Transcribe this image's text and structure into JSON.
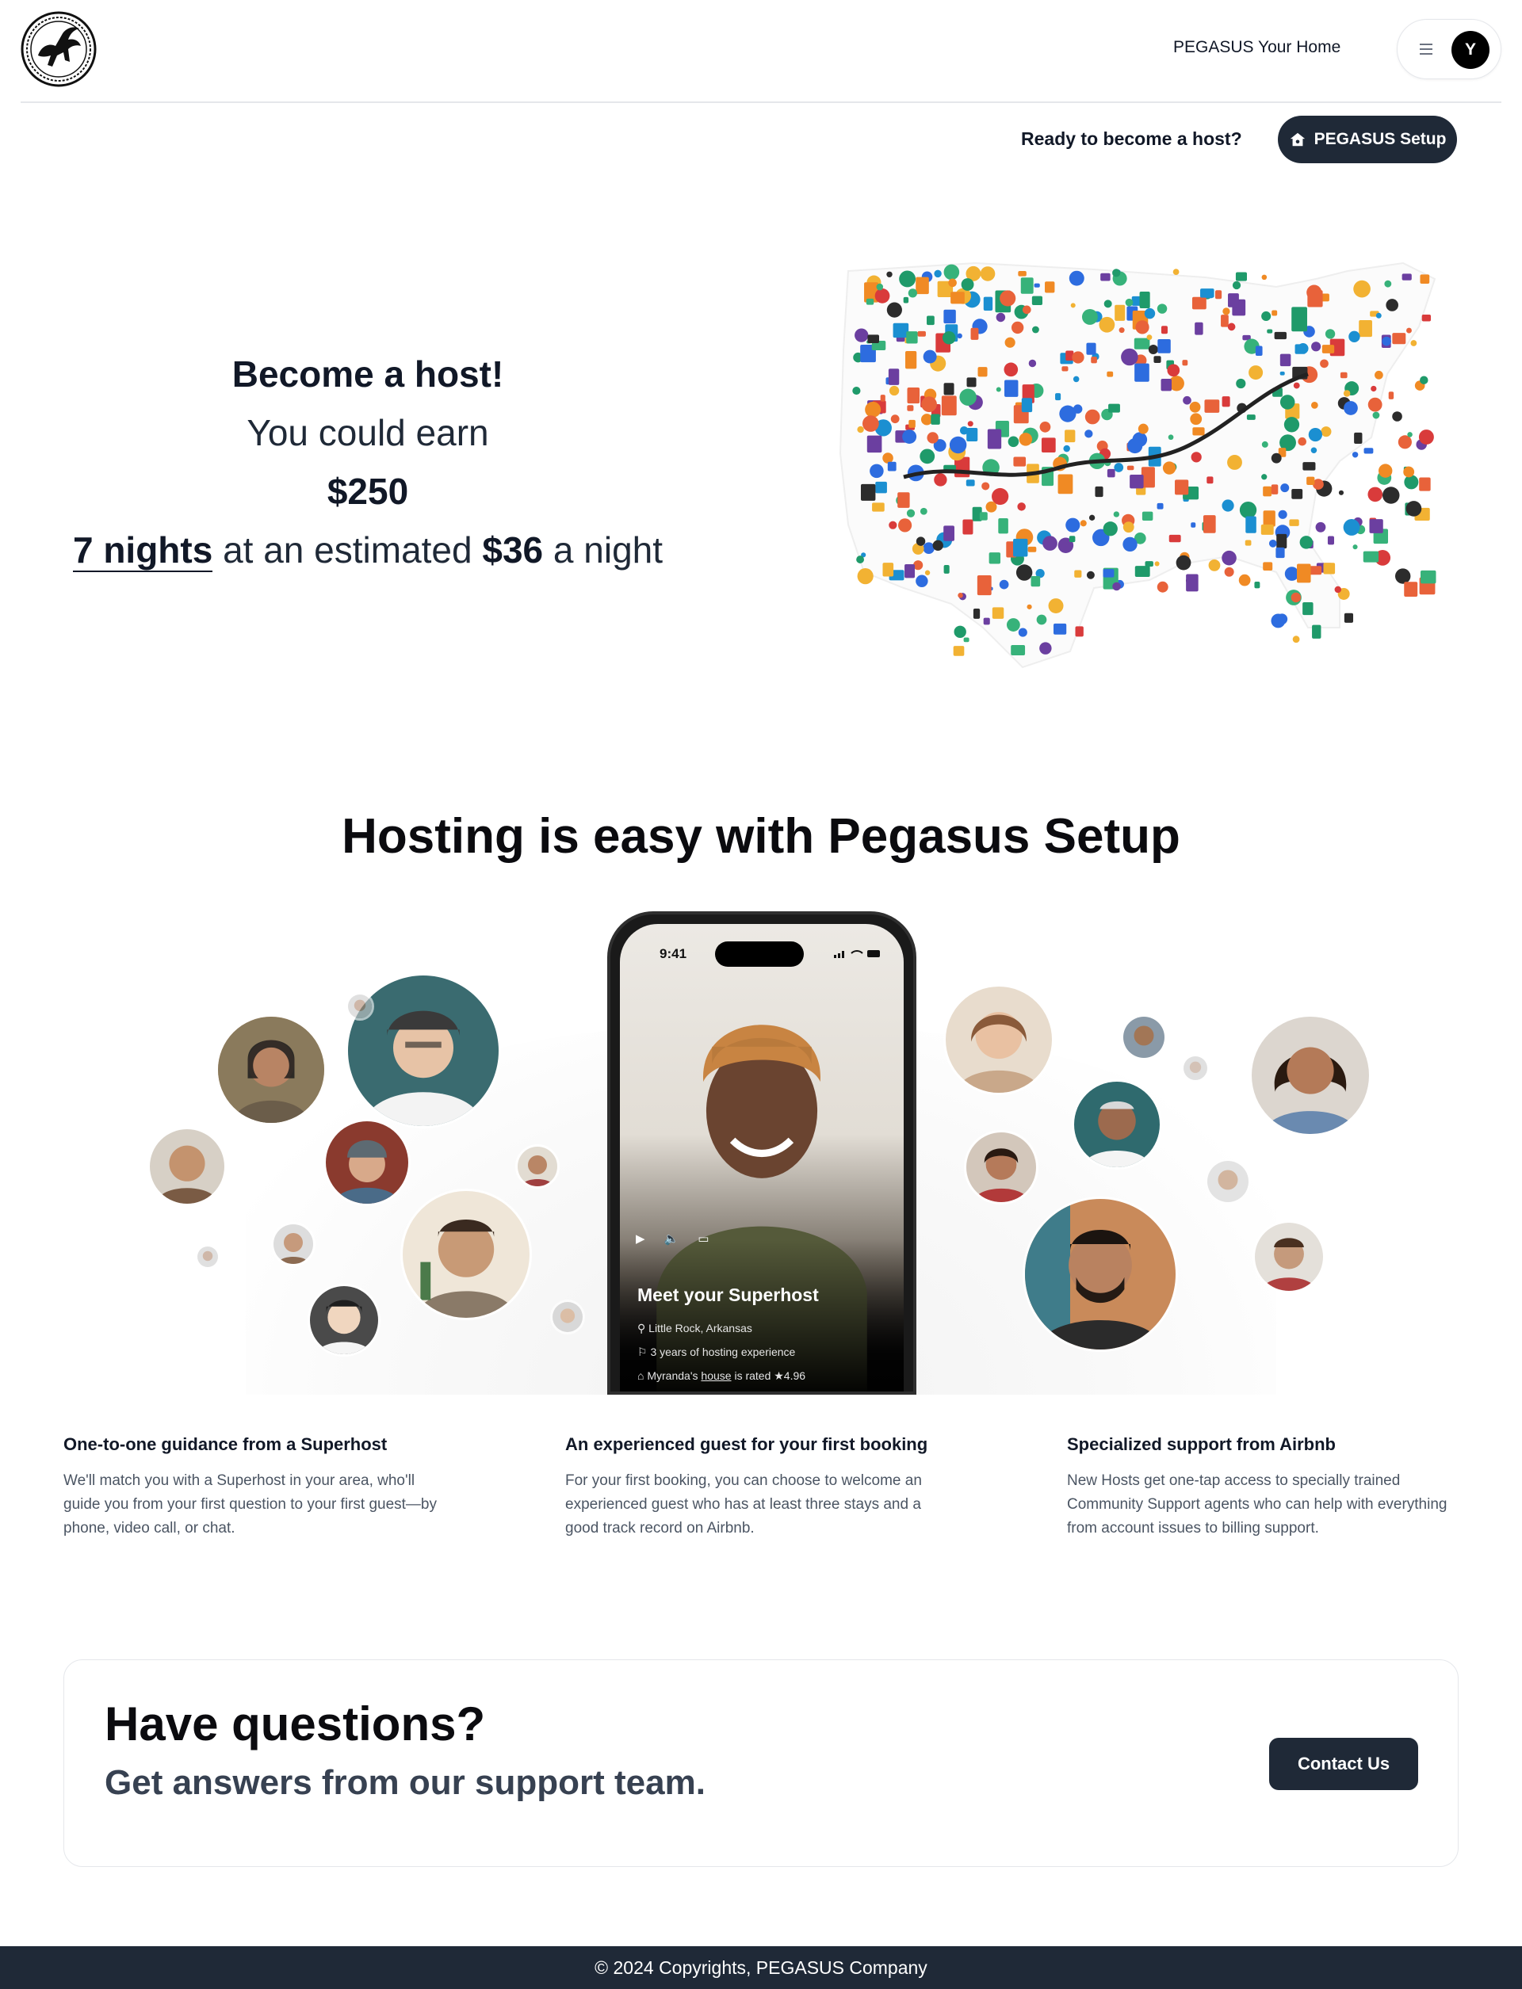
{
  "header": {
    "brand_link": "PEGASUS Your Home",
    "avatar_initial": "Y"
  },
  "host_cta": {
    "question": "Ready to become a host?",
    "setup_label": "PEGASUS Setup"
  },
  "hero": {
    "title": "Become a host!",
    "earn_text": "You could earn",
    "amount": "$250",
    "nights": "7 nights",
    "estimate_text": " at an estimated ",
    "price": "$36",
    "per_night": " a night"
  },
  "section": {
    "title": "Hosting is easy with Pegasus Setup"
  },
  "phone": {
    "time": "9:41",
    "heading": "Meet your Superhost",
    "location": "Little Rock, Arkansas",
    "experience": "3 years of hosting experience",
    "rating_prefix": "Myranda's",
    "rating_link": "house",
    "rating_suffix": "is rated ★4.96"
  },
  "features": [
    {
      "title": "One-to-one guidance from a Superhost",
      "body": "We'll match you with a Superhost in your area, who'll guide you from your first question to your first guest—by phone, video call, or chat."
    },
    {
      "title": "An experienced guest for your first booking",
      "body": "For your first booking, you can choose to welcome an experienced guest who has at least three stays and a good track record on Airbnb."
    },
    {
      "title": "Specialized support from Airbnb",
      "body": "New Hosts get one-tap access to specially trained Community Support agents who can help with everything from account issues to billing support."
    }
  ],
  "questions": {
    "title": "Have questions?",
    "subtitle": "Get answers from our support team.",
    "contact_label": "Contact Us"
  },
  "footer": {
    "copyright": "© 2024 Copyrights, PEGASUS Company"
  },
  "colors": {
    "dark_button": "#1f2937",
    "text_primary": "#111827",
    "text_muted": "#4b5563"
  }
}
